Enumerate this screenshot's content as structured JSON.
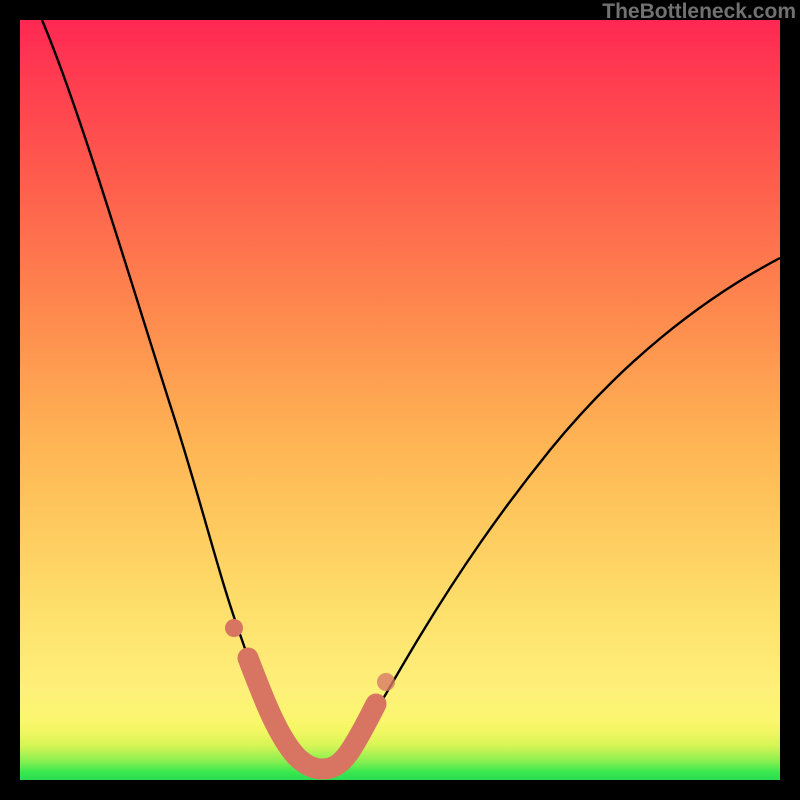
{
  "attribution": "TheBottleneck.com",
  "chart_data": {
    "type": "line",
    "title": "",
    "xlabel": "",
    "ylabel": "",
    "xlim": [
      0,
      100
    ],
    "ylim": [
      0,
      100
    ],
    "series": [
      {
        "name": "bottleneck-curve",
        "x": [
          3,
          6,
          10,
          14,
          18,
          22,
          25,
          27,
          29,
          31,
          33,
          35,
          37,
          40,
          44,
          50,
          56,
          62,
          70,
          80,
          90,
          100
        ],
        "y": [
          100,
          91,
          79,
          66,
          53,
          39,
          27,
          19,
          12,
          7,
          3,
          2,
          2,
          3,
          6,
          13,
          22,
          32,
          43,
          54,
          62,
          68
        ]
      }
    ],
    "highlight_band": {
      "x_range": [
        27,
        42
      ],
      "y_range": [
        2,
        18
      ],
      "endpoint_dots": true
    },
    "background_gradient": [
      "#ff2853",
      "#fee06c",
      "#fbf66f",
      "#2bdc52"
    ],
    "description": "V-shaped bottleneck curve on a vertical rainbow heat gradient; a thick salmon segment with round endpoints marks the near-optimal trough region."
  }
}
